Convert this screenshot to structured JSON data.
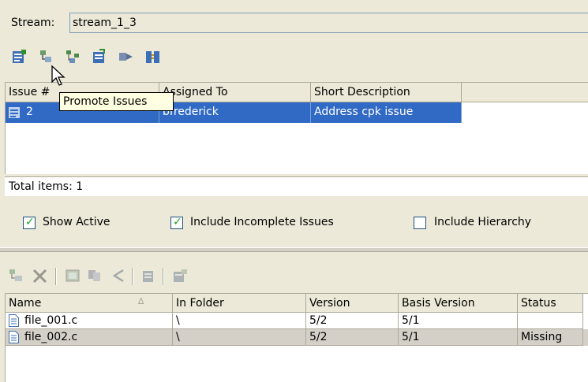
{
  "stream": {
    "label": "Stream:",
    "value": "stream_1_3"
  },
  "toolbar_top": {
    "icons": [
      "issue-properties-icon",
      "promote-issues-icon",
      "promote-hierarchy-icon",
      "view-issue-icon",
      "send-icon",
      "compare-icon"
    ]
  },
  "tooltip": "Promote Issues",
  "issues_table": {
    "columns": [
      "Issue #",
      "Assigned To",
      "Short Description"
    ],
    "rows": [
      {
        "issue": "2",
        "assigned_to": "bfrederick",
        "description": "Address cpk issue"
      }
    ]
  },
  "total_items": "Total items: 1",
  "filters": {
    "show_active": {
      "label": "Show Active",
      "checked": true
    },
    "include_incomplete": {
      "label": "Include Incomplete Issues",
      "checked": true
    },
    "include_hierarchy": {
      "label": "Include Hierarchy",
      "checked": false
    }
  },
  "toolbar_bottom": {
    "icons": [
      "promote-icon",
      "remove-icon",
      "diff-icon",
      "copy-icon",
      "history-icon",
      "open-icon",
      "properties-icon"
    ]
  },
  "files_table": {
    "columns": [
      "Name",
      "In Folder",
      "Version",
      "Basis Version",
      "Status"
    ],
    "sort_indicator": "∆",
    "rows": [
      {
        "name": "file_001.c",
        "folder": "\\",
        "version": "5/2",
        "basis": "5/1",
        "status": ""
      },
      {
        "name": "file_002.c",
        "folder": "\\",
        "version": "5/2",
        "basis": "5/1",
        "status": "Missing"
      }
    ]
  },
  "colors": {
    "selection": "#316ac5",
    "window": "#ece9d8",
    "tooltip": "#ffffe1",
    "check": "#21a121"
  }
}
